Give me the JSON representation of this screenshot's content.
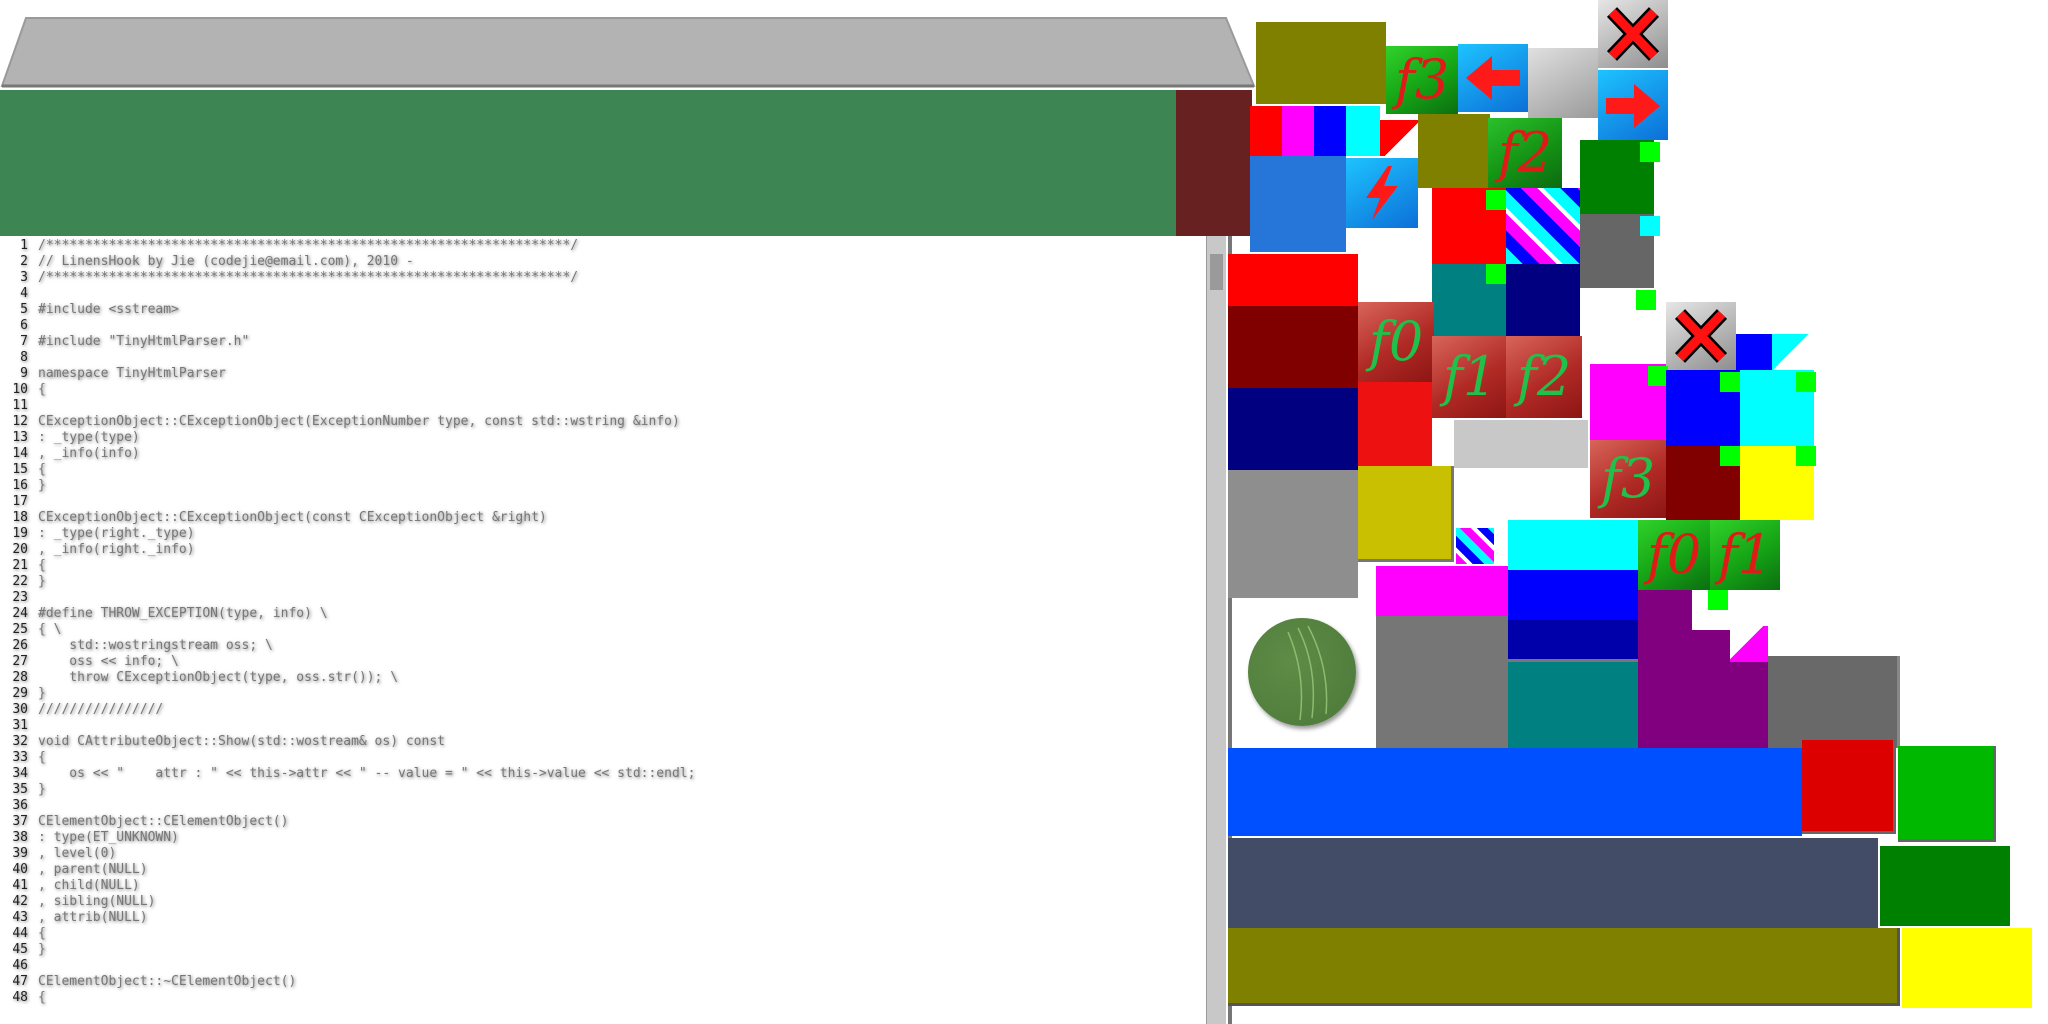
{
  "function_keys": {
    "f0": "f0",
    "f1": "f1",
    "f2": "f2",
    "f3": "f3"
  },
  "code": [
    {
      "n": "1",
      "t": "/*******************************************************************/"
    },
    {
      "n": "2",
      "t": "// LinensHook by Jie (codejie@email.com), 2010 -"
    },
    {
      "n": "3",
      "t": "/*******************************************************************/"
    },
    {
      "n": "4",
      "t": ""
    },
    {
      "n": "5",
      "t": "#include <sstream>"
    },
    {
      "n": "6",
      "t": ""
    },
    {
      "n": "7",
      "t": "#include \"TinyHtmlParser.h\""
    },
    {
      "n": "8",
      "t": ""
    },
    {
      "n": "9",
      "t": "namespace TinyHtmlParser"
    },
    {
      "n": "10",
      "t": "{"
    },
    {
      "n": "11",
      "t": ""
    },
    {
      "n": "12",
      "t": "CExceptionObject::CExceptionObject(ExceptionNumber type, const std::wstring &info)"
    },
    {
      "n": "13",
      "t": ": _type(type)"
    },
    {
      "n": "14",
      "t": ", _info(info)"
    },
    {
      "n": "15",
      "t": "{"
    },
    {
      "n": "16",
      "t": "}"
    },
    {
      "n": "17",
      "t": ""
    },
    {
      "n": "18",
      "t": "CExceptionObject::CExceptionObject(const CExceptionObject &right)"
    },
    {
      "n": "19",
      "t": ": _type(right._type)"
    },
    {
      "n": "20",
      "t": ", _info(right._info)"
    },
    {
      "n": "21",
      "t": "{"
    },
    {
      "n": "22",
      "t": "}"
    },
    {
      "n": "23",
      "t": ""
    },
    {
      "n": "24",
      "t": "#define THROW_EXCEPTION(type, info) \\"
    },
    {
      "n": "25",
      "t": "{ \\"
    },
    {
      "n": "26",
      "t": "    std::wostringstream oss; \\"
    },
    {
      "n": "27",
      "t": "    oss << info; \\"
    },
    {
      "n": "28",
      "t": "    throw CExceptionObject(type, oss.str()); \\"
    },
    {
      "n": "29",
      "t": "}"
    },
    {
      "n": "30",
      "t": "////////////////"
    },
    {
      "n": "31",
      "t": ""
    },
    {
      "n": "32",
      "t": "void CAttributeObject::Show(std::wostream& os) const"
    },
    {
      "n": "33",
      "t": "{"
    },
    {
      "n": "34",
      "t": "    os << \"    attr : \" << this->attr << \" -- value = \" << this->value << std::endl;"
    },
    {
      "n": "35",
      "t": "}"
    },
    {
      "n": "36",
      "t": ""
    },
    {
      "n": "37",
      "t": "CElementObject::CElementObject()"
    },
    {
      "n": "38",
      "t": ": type(ET_UNKNOWN)"
    },
    {
      "n": "39",
      "t": ", level(0)"
    },
    {
      "n": "40",
      "t": ", parent(NULL)"
    },
    {
      "n": "41",
      "t": ", child(NULL)"
    },
    {
      "n": "42",
      "t": ", sibling(NULL)"
    },
    {
      "n": "43",
      "t": ", attrib(NULL)"
    },
    {
      "n": "44",
      "t": "{"
    },
    {
      "n": "45",
      "t": "}"
    },
    {
      "n": "46",
      "t": ""
    },
    {
      "n": "47",
      "t": "CElementObject::~CElementObject()"
    },
    {
      "n": "48",
      "t": "{"
    }
  ],
  "colors": {
    "header_green": "#3d8553",
    "header_maroon": "#672121",
    "toolbar_gray": "#b4b4b4"
  },
  "icons": [
    "close-icon",
    "arrow-left-icon",
    "arrow-right-icon",
    "lightning-icon"
  ]
}
